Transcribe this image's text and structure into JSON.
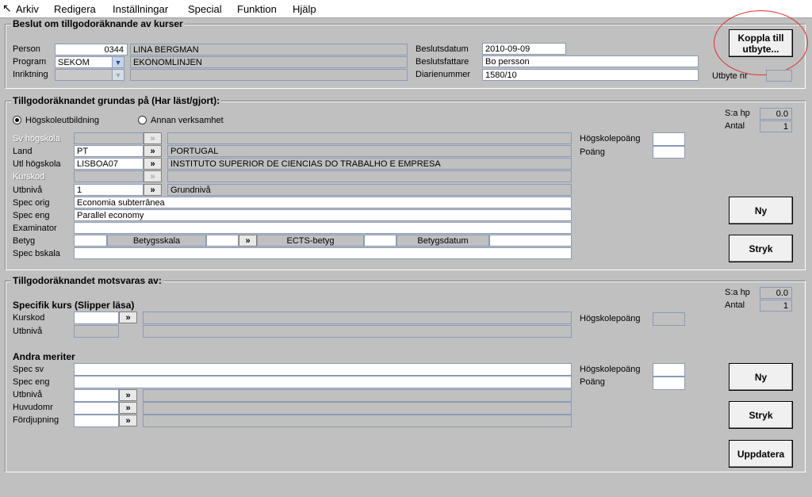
{
  "menu": [
    "Arkiv",
    "Redigera",
    "Inställningar",
    "Special",
    "Funktion",
    "Hjälp"
  ],
  "beslut": {
    "title": "Beslut om tillgodoräknande av kurser",
    "person_label": "Person",
    "person_id": "0344",
    "person_name": "LINA BERGMAN",
    "program_label": "Program",
    "program_value": "SEKOM",
    "program_name": "EKONOMLINJEN",
    "inriktning_label": "Inriktning",
    "beslutsdatum_label": "Beslutsdatum",
    "beslutsdatum": "2010-09-09",
    "beslutsfattare_label": "Beslutsfattare",
    "beslutsfattare": "Bo persson",
    "diarienummer_label": "Diarienummer",
    "diarienummer": "1580/10",
    "koppla_button": "Koppla till utbyte...",
    "utbyte_label": "Utbyte nr"
  },
  "grundas": {
    "title": "Tillgodoräknandet grundas på (Har läst/gjort):",
    "radio_hogskola": "Högskoleutbildning",
    "radio_annan": "Annan verksamhet",
    "sahp_label": "S:a hp",
    "sahp": "0.0",
    "antal_label": "Antal",
    "antal": "1",
    "sv_hogskola_label": "Sv högskola",
    "land_label": "Land",
    "land_code": "PT",
    "land_name": "PORTUGAL",
    "utl_label": "Utl högskola",
    "utl_code": "LISBOA07",
    "utl_name": "INSTITUTO SUPERIOR DE CIENCIAS DO TRABALHO E EMPRESA",
    "kurskod_label": "Kurskod",
    "utbniva_label": "Utbnivå",
    "utbniva_code": "1",
    "utbniva_name": "Grundnivå",
    "spec_orig_label": "Spec orig",
    "spec_orig": "Economia subterrânea",
    "spec_eng_label": "Spec eng",
    "spec_eng": "Parallel economy",
    "examinator_label": "Examinator",
    "betyg_label": "Betyg",
    "betygsskala_label": "Betygsskala",
    "ects_label": "ECTS-betyg",
    "betygsdatum_label": "Betygsdatum",
    "spec_bskala_label": "Spec bskala",
    "hogskolepoang_label": "Högskolepoäng",
    "poang_label": "Poäng",
    "ny_button": "Ny",
    "stryk_button": "Stryk"
  },
  "motsvaras": {
    "title": "Tillgodoräknandet motsvaras av:",
    "sahp_label": "S:a hp",
    "sahp": "0.0",
    "antal_label": "Antal",
    "antal": "1",
    "specifik_title": "Specifik kurs (Slipper läsa)",
    "kurskod_label": "Kurskod",
    "utbniva_label": "Utbnivå",
    "hogskolepoang_label": "Högskolepoäng",
    "andra_title": "Andra meriter",
    "spec_sv_label": "Spec sv",
    "spec_eng_label": "Spec eng",
    "utbniva2_label": "Utbnivå",
    "huvudomr_label": "Huvudomr",
    "fordjupning_label": "Fördjupning",
    "hogskolepoang2_label": "Högskolepoäng",
    "poang_label": "Poäng",
    "ny_button": "Ny",
    "stryk_button": "Stryk",
    "uppdatera_button": "Uppdatera"
  },
  "symbols": {
    "double_arrow": "»",
    "chevron": "⌄"
  },
  "colors": {
    "background": "#c0c0c0",
    "field_border": "#8a9bb6",
    "annotation": "#e03030"
  }
}
